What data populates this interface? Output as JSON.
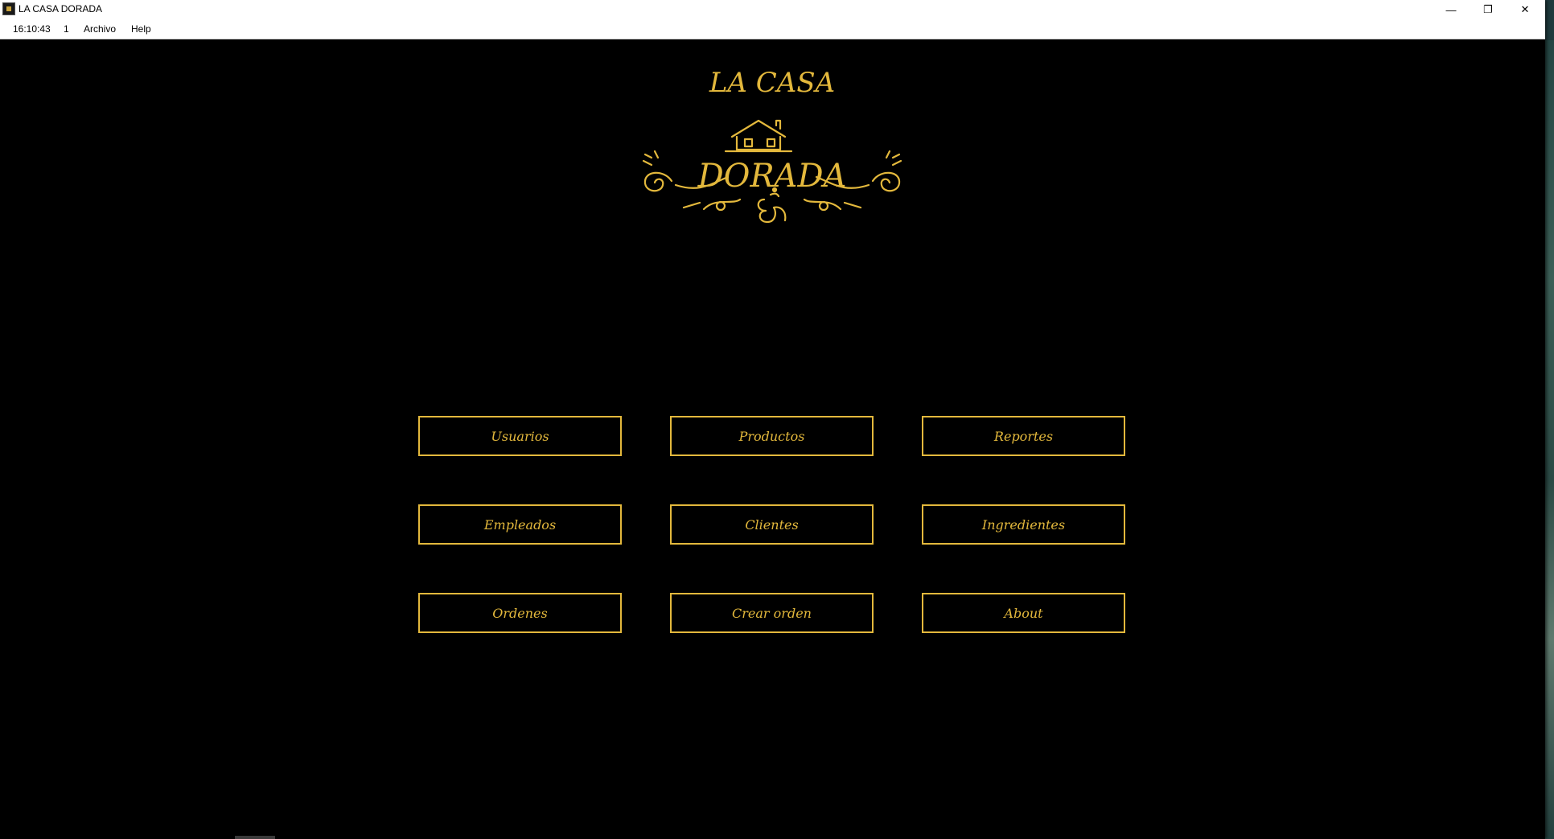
{
  "window": {
    "title": "LA CASA DORADA",
    "controls": {
      "minimize": "—",
      "maximize": "❐",
      "close": "✕"
    }
  },
  "menubar": {
    "clock": "16:10:43",
    "counter": "1",
    "archivo": "Archivo",
    "help": "Help"
  },
  "logo": {
    "line1": "LA CASA",
    "line2": "DORADA",
    "accent_color": "#e3b83c"
  },
  "buttons": {
    "usuarios": "Usuarios",
    "productos": "Productos",
    "reportes": "Reportes",
    "empleados": "Empleados",
    "clientes": "Clientes",
    "ingredientes": "Ingredientes",
    "ordenes": "Ordenes",
    "crear_orden": "Crear orden",
    "about": "About"
  },
  "colors": {
    "background": "#000000",
    "gold": "#e3b83c"
  }
}
